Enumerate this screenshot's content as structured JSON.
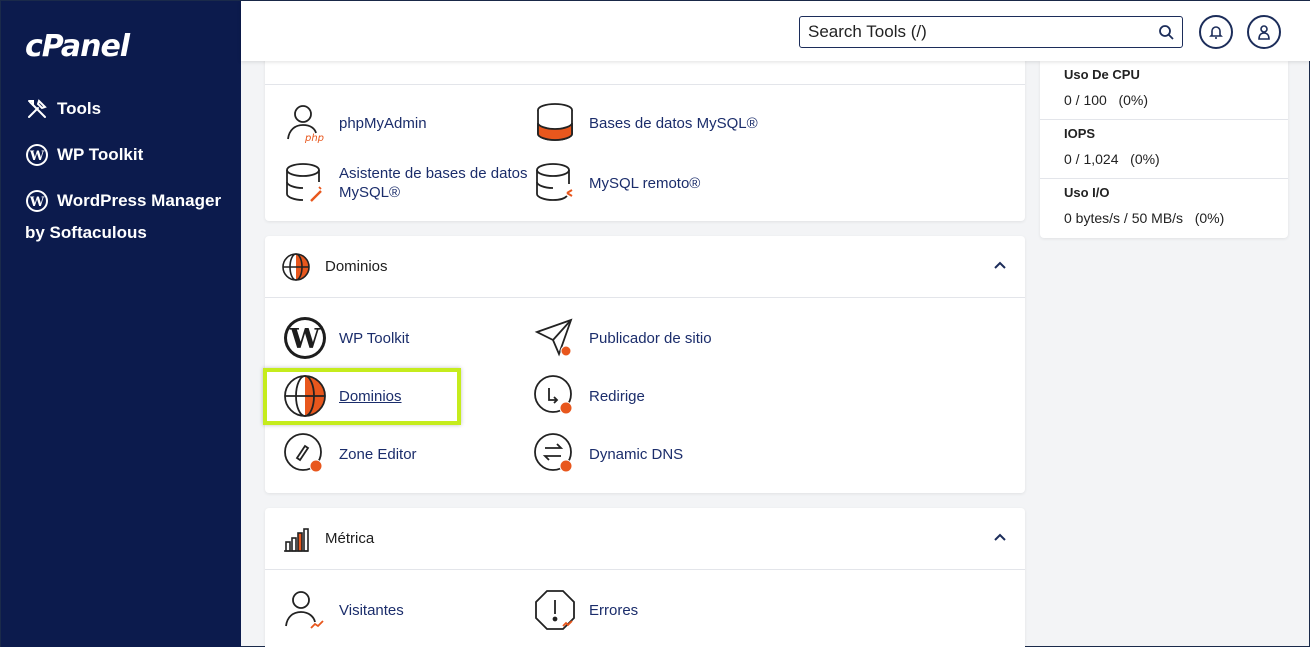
{
  "sidebar": {
    "logo": "cPanel",
    "items": [
      {
        "label": "Tools",
        "icon": "tools-icon"
      },
      {
        "label": "WP Toolkit",
        "icon": "wordpress-icon"
      },
      {
        "label": "WordPress Manager",
        "icon": "wordpress-icon"
      }
    ],
    "sub_label": "by Softaculous"
  },
  "topbar": {
    "search_placeholder": "Search Tools (/)"
  },
  "databases": {
    "tools": [
      {
        "label": "phpMyAdmin"
      },
      {
        "label": "Bases de datos MySQL®"
      },
      {
        "label_line1": "Asistente de bases de datos",
        "label_line2": "MySQL®"
      },
      {
        "label": "MySQL remoto®"
      }
    ]
  },
  "domains": {
    "title": "Dominios",
    "tools": [
      {
        "label": "WP Toolkit"
      },
      {
        "label": "Publicador de sitio"
      },
      {
        "label": "Dominios"
      },
      {
        "label": "Redirige"
      },
      {
        "label": "Zone Editor"
      },
      {
        "label": "Dynamic DNS"
      }
    ]
  },
  "metrics": {
    "title": "Métrica",
    "tools": [
      {
        "label": "Visitantes"
      },
      {
        "label": "Errores"
      }
    ]
  },
  "stats": [
    {
      "title": "Uso De CPU",
      "value": "0 / 100   (0%)"
    },
    {
      "title": "IOPS",
      "value": "0 / 1,024   (0%)"
    },
    {
      "title": "Uso I/O",
      "value": "0 bytes/s / 50 MB/s   (0%)"
    }
  ],
  "colors": {
    "sidebar": "#0c1b4d",
    "accent": "#e8571d",
    "link": "#1b2d6b",
    "highlight": "#c5ec1d"
  }
}
